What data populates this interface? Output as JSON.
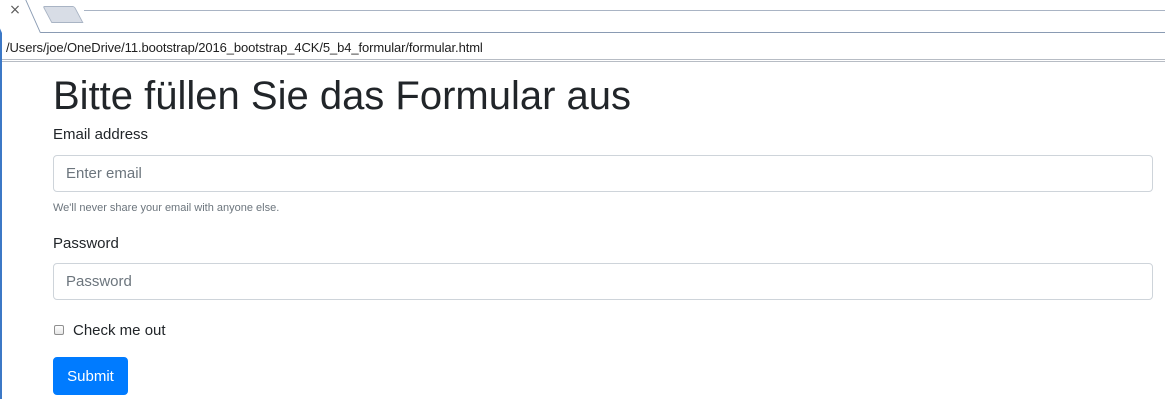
{
  "browser": {
    "tab_close_glyph": "×",
    "address": "/Users/joe/OneDrive/11.bootstrap/2016_bootstrap_4CK/5_b4_formular/formular.html"
  },
  "form": {
    "title": "Bitte füllen Sie das Formular aus",
    "email": {
      "label": "Email address",
      "placeholder": "Enter email",
      "value": "",
      "help": "We'll never share your email with anyone else."
    },
    "password": {
      "label": "Password",
      "placeholder": "Password",
      "value": ""
    },
    "check": {
      "label": "Check me out",
      "checked": false
    },
    "submit_label": "Submit"
  },
  "colors": {
    "primary": "#007bff",
    "text": "#212529",
    "muted": "#6c757d",
    "border": "#ced4da",
    "window_border": "#3c78c6"
  },
  "icons": {
    "tab_close": "close-icon",
    "checkbox": "checkbox-unchecked-icon"
  }
}
